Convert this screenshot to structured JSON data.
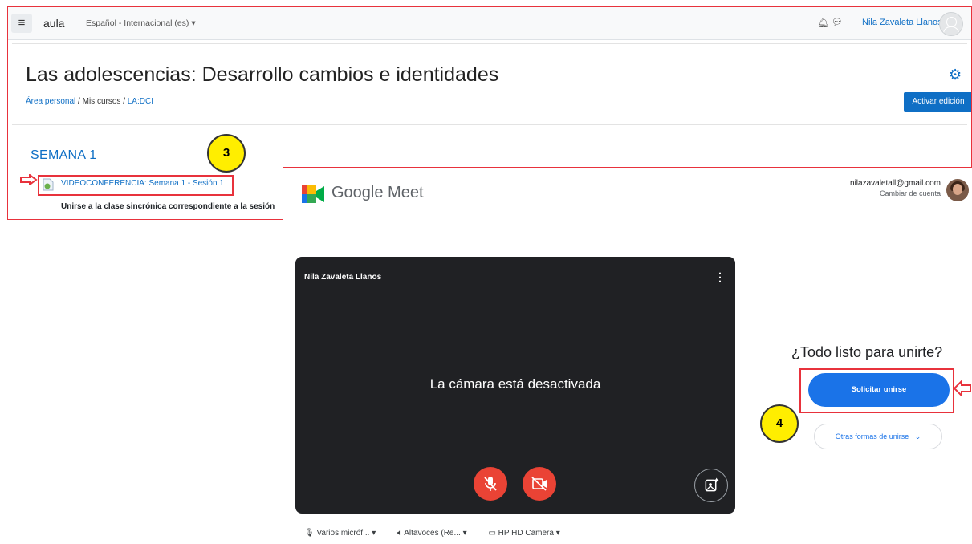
{
  "moodle": {
    "menu_icon": "hamburger-menu-icon",
    "site_name": "aula",
    "language": "Español - Internacional (es) ▾",
    "notifications_icon": "bell-icon",
    "messages_icon": "chat-bubble-icon",
    "user_name": "Nila Zavaleta Llanos",
    "course_title": "Las adolescencias: Desarrollo cambios e identidades",
    "settings_icon": "gear-icon",
    "breadcrumb": {
      "items": [
        "Área personal",
        "Mis cursos",
        "LA:DCI"
      ],
      "separator": "/"
    },
    "edit_button": "Activar edición",
    "section_title": "SEMANA 1",
    "activity": {
      "icon": "url-resource-icon",
      "link": "VIDEOCONFERENCIA: Semana 1 - Sesión 1",
      "description": "Unirse a la clase sincrónica correspondiente a la sesión"
    }
  },
  "annotations": {
    "step_3": "3",
    "step_4": "4",
    "highlight_color": "#e8323c",
    "marker_color": "#ffee00"
  },
  "meet": {
    "brand": "Google Meet",
    "account_email": "nilazavaletall@gmail.com",
    "switch_account": "Cambiar de cuenta",
    "preview_name": "Nila Zavaleta Llanos",
    "camera_off": "La cámara está desactivada",
    "ready_prompt": "¿Todo listo para unirte?",
    "ask_to_join": "Solicitar unirse",
    "other_ways": "Otras formas de unirse",
    "devices": {
      "microphone": "Varios micróf...",
      "speakers": "Altavoces (Re...",
      "camera": "HP HD Camera"
    },
    "colors": {
      "primary": "#1a73e8",
      "danger": "#ea4335",
      "preview_bg": "#202124"
    }
  }
}
